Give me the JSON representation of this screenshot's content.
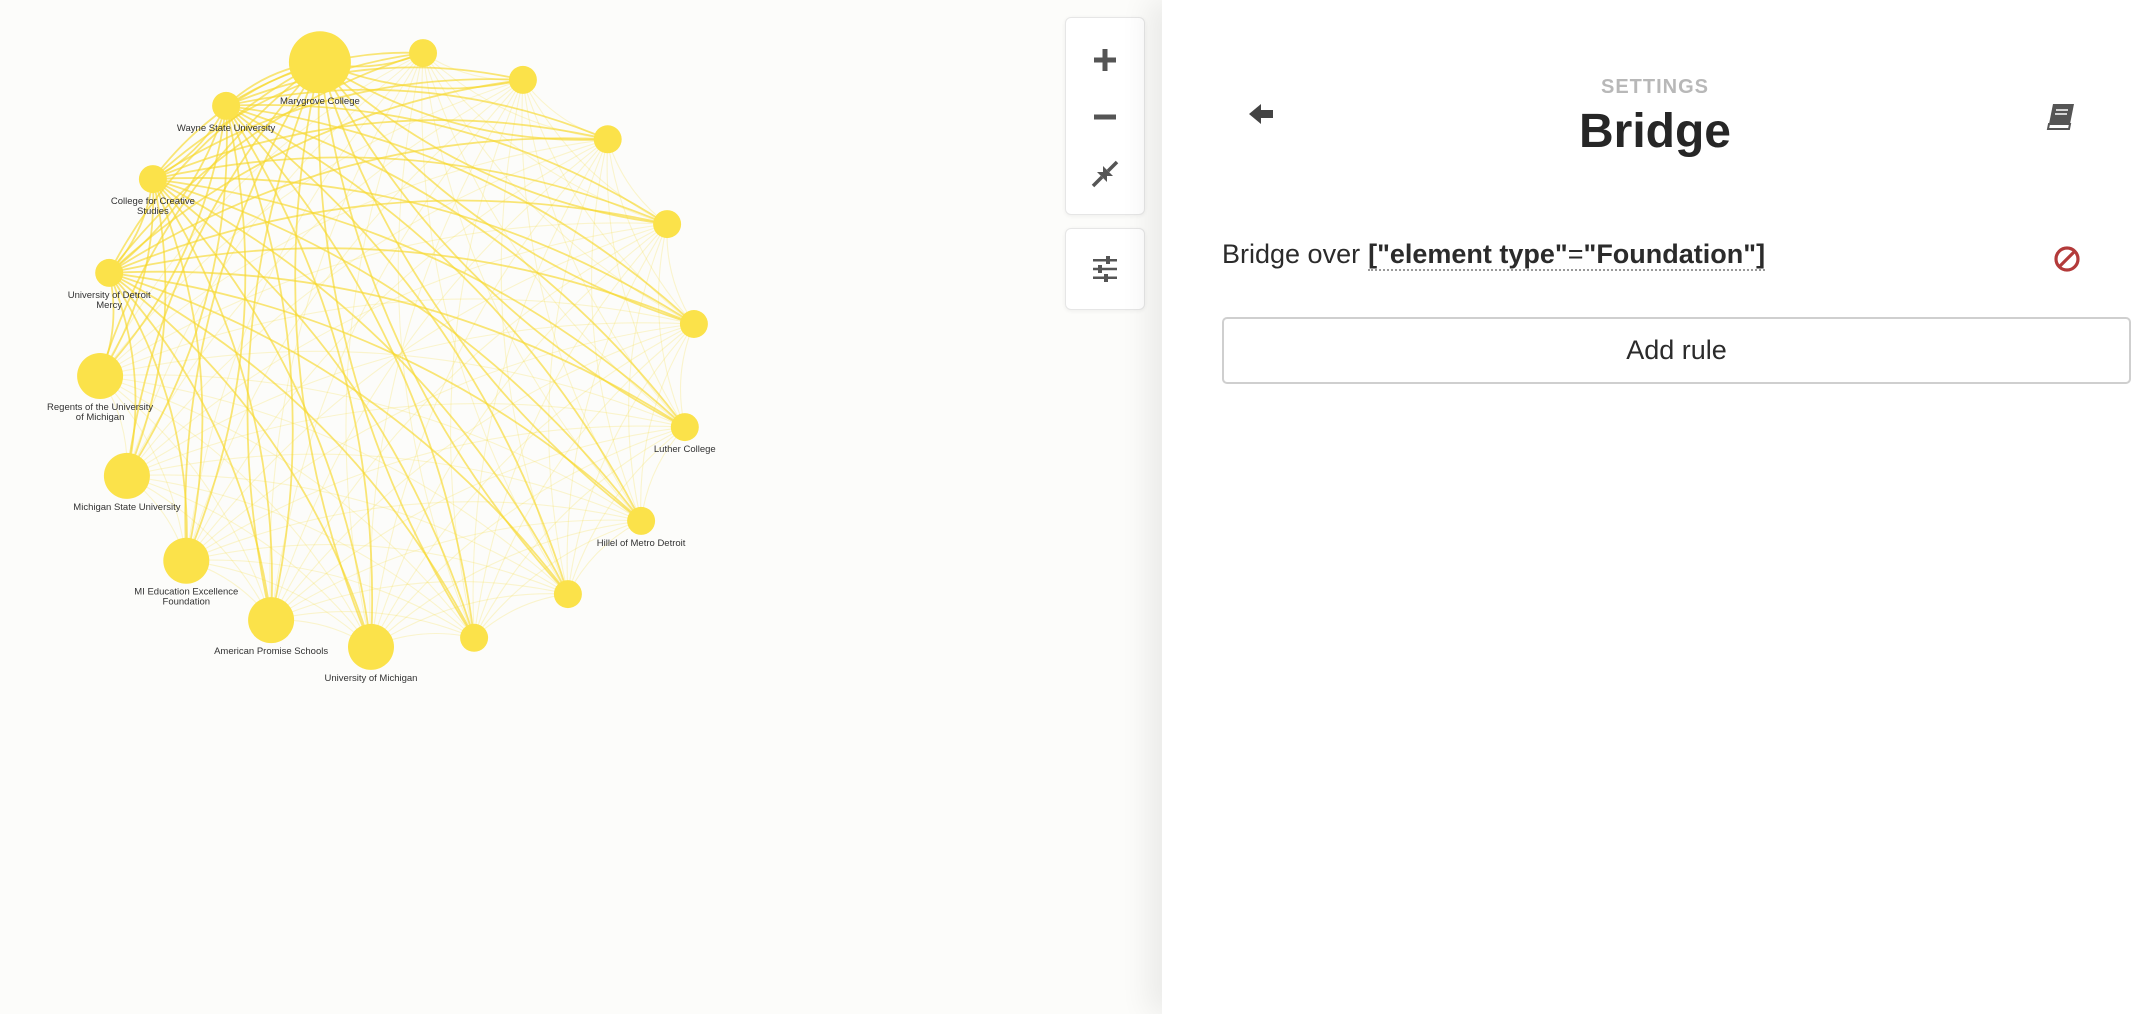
{
  "graph": {
    "node_color": "#fbe24a",
    "edge_color": "#f7d92e",
    "nodes": [
      {
        "id": "marygrove",
        "label_lines": [
          "Marygrove College"
        ],
        "size": "large"
      },
      {
        "id": "n1",
        "label_lines": [],
        "size": "small"
      },
      {
        "id": "n2",
        "label_lines": [],
        "size": "small"
      },
      {
        "id": "n3",
        "label_lines": [],
        "size": "small"
      },
      {
        "id": "n4",
        "label_lines": [],
        "size": "small"
      },
      {
        "id": "n5",
        "label_lines": [],
        "size": "small"
      },
      {
        "id": "luther",
        "label_lines": [
          "Luther College"
        ],
        "size": "small"
      },
      {
        "id": "hillel",
        "label_lines": [
          "Hillel of Metro Detroit"
        ],
        "size": "small"
      },
      {
        "id": "n8",
        "label_lines": [],
        "size": "small"
      },
      {
        "id": "n9",
        "label_lines": [],
        "size": "small"
      },
      {
        "id": "umich",
        "label_lines": [
          "University of Michigan"
        ],
        "size": "medium"
      },
      {
        "id": "aps",
        "label_lines": [
          "American Promise Schools"
        ],
        "size": "medium"
      },
      {
        "id": "miedu",
        "label_lines": [
          "MI Education Excellence",
          "Foundation"
        ],
        "size": "medium"
      },
      {
        "id": "msu",
        "label_lines": [
          "Michigan State University"
        ],
        "size": "medium"
      },
      {
        "id": "regents",
        "label_lines": [
          "Regents of the University",
          "of Michigan"
        ],
        "size": "medium"
      },
      {
        "id": "udm",
        "label_lines": [
          "University of Detroit",
          "Mercy"
        ],
        "size": "small"
      },
      {
        "id": "ccs",
        "label_lines": [
          "College for Creative",
          "Studies"
        ],
        "size": "small"
      },
      {
        "id": "wsu",
        "label_lines": [
          "Wayne State University"
        ],
        "size": "small"
      }
    ]
  },
  "controls": {
    "zoom_in_icon": "plus-icon",
    "zoom_out_icon": "minus-icon",
    "fit_icon": "compress-arrows-icon",
    "filter_icon": "sliders-icon"
  },
  "settings": {
    "eyebrow": "SETTINGS",
    "title": "Bridge",
    "back_icon": "arrow-left-icon",
    "docs_icon": "book-icon",
    "rule": {
      "prefix": "Bridge over",
      "selector_open": "[\"element type\"",
      "selector_eq": "=",
      "selector_value": "\"Foundation\"]",
      "remove_icon": "ban-icon",
      "remove_color": "#b33a3a"
    },
    "add_rule_label": "Add rule"
  }
}
